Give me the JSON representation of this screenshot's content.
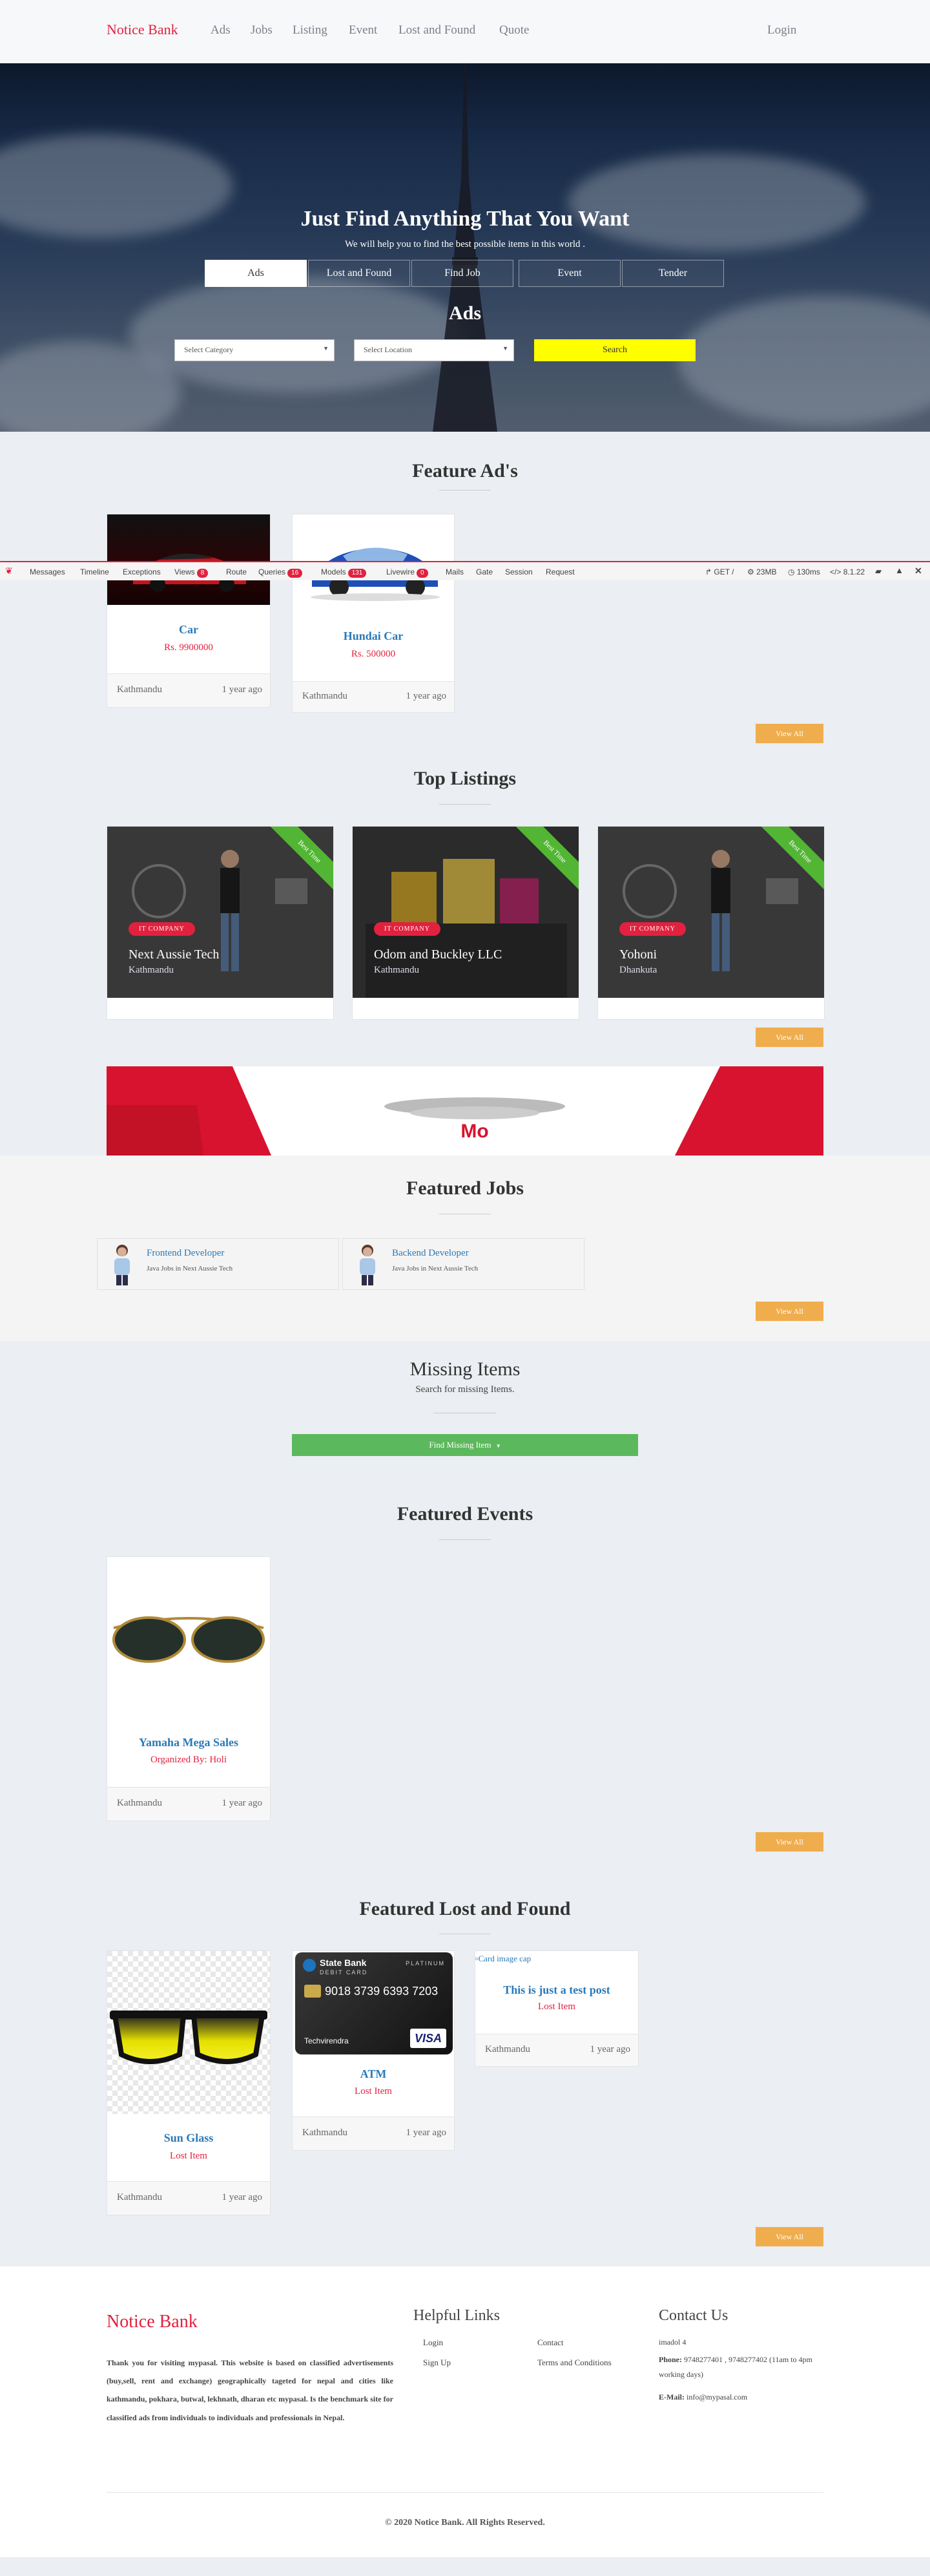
{
  "nav": {
    "brand": "Notice Bank",
    "links": [
      "Ads",
      "Jobs",
      "Listing",
      "Event",
      "Lost and Found",
      "Quote"
    ],
    "login": "Login"
  },
  "hero": {
    "title": "Just Find Anything That You Want",
    "subtitle": "We will help you to find the best possible items in this world .",
    "tabs": [
      "Ads",
      "Lost and Found",
      "Find Job",
      "Event",
      "Tender"
    ],
    "active_heading": "Ads",
    "category_placeholder": "Select Category",
    "location_placeholder": "Select Location",
    "search_label": "Search"
  },
  "featured_ads": {
    "title": "Feature Ad's",
    "items": [
      {
        "title": "Car",
        "price": "Rs. 9900000",
        "location": "Kathmandu",
        "time": "1 year ago"
      },
      {
        "title": "Hundai Car",
        "price": "Rs. 500000",
        "location": "Kathmandu",
        "time": "1 year ago"
      }
    ],
    "view_all": "View All"
  },
  "debugbar": {
    "tabs": [
      "Messages",
      "Timeline",
      "Exceptions",
      "Views",
      "Route",
      "Queries",
      "Models",
      "Livewire",
      "Mails",
      "Gate",
      "Session",
      "Request"
    ],
    "badges": {
      "Views": "8",
      "Queries": "16",
      "Models": "131",
      "Livewire": "0"
    },
    "method": "GET /",
    "memory": "23MB",
    "time": "130ms",
    "version": "8.1.22"
  },
  "top_listings": {
    "title": "Top Listings",
    "ribbon": "Best Time",
    "badge": "IT COMPANY",
    "items": [
      {
        "name": "Next Aussie Tech",
        "location": "Kathmandu"
      },
      {
        "name": "Odom and Buckley LLC",
        "location": "Kathmandu"
      },
      {
        "name": "Yohoni",
        "location": "Dhankuta"
      }
    ],
    "view_all": "View All"
  },
  "banner": {
    "text": "Mo"
  },
  "featured_jobs": {
    "title": "Featured Jobs",
    "items": [
      {
        "title": "Frontend Developer",
        "subtitle": "Java Jobs in Next Aussie Tech"
      },
      {
        "title": "Backend Developer",
        "subtitle": "Java Jobs in Next Aussie Tech"
      }
    ],
    "view_all": "View All"
  },
  "missing": {
    "title": "Missing Items",
    "subtitle": "Search for missing Items.",
    "button": "Find Missing Item"
  },
  "featured_events": {
    "title": "Featured Events",
    "items": [
      {
        "title": "Yamaha Mega Sales",
        "organizer": "Organized By: Holi",
        "location": "Kathmandu",
        "time": "1 year ago"
      }
    ],
    "view_all": "View All"
  },
  "lost_found": {
    "title": "Featured Lost and Found",
    "items": [
      {
        "title": "Sun Glass",
        "tag": "Lost Item",
        "location": "Kathmandu",
        "time": "1 year ago"
      },
      {
        "title": "ATM",
        "tag": "Lost Item",
        "location": "Kathmandu",
        "time": "1 year ago"
      },
      {
        "title": "This is just a test post",
        "tag": "Lost Item",
        "location": "Kathmandu",
        "time": "1 year ago",
        "alt": "Card image cap"
      }
    ],
    "atm_card": {
      "bank": "State Bank",
      "type": "DEBIT CARD",
      "tier": "PLATINUM",
      "number": "9018 3739 6393 7203",
      "holder": "Techvirendra",
      "network": "VISA"
    },
    "view_all": "View All"
  },
  "footer": {
    "brand": "Notice Bank",
    "about": "Thank you for visiting mypasal. This website is based on classified advertisements (buy,sell, rent and exchange) geographically tageted for nepal and cities like kathmandu, pokhara, butwal, lekhnath, dharan etc mypasal. Is the benchmark site for classified ads from individuals to individuals and professionals in Nepal.",
    "links_title": "Helpful Links",
    "links": [
      "Login",
      "Contact",
      "Sign Up",
      "Terms and Conditions"
    ],
    "contact_title": "Contact Us",
    "address": "imadol 4",
    "phone_label": "Phone:",
    "phone": "9748277401 , 9748277402 (11am to 4pm working days)",
    "email_label": "E-Mail:",
    "email": "info@mypasal.com",
    "copyright": "© 2020 Notice Bank. All Rights Reserved."
  },
  "colors": {
    "brand": "#e2213f",
    "link": "#2a7ab8",
    "view_all": "#f0ad4e",
    "search": "#ffff00",
    "find_missing": "#5cb85c"
  }
}
